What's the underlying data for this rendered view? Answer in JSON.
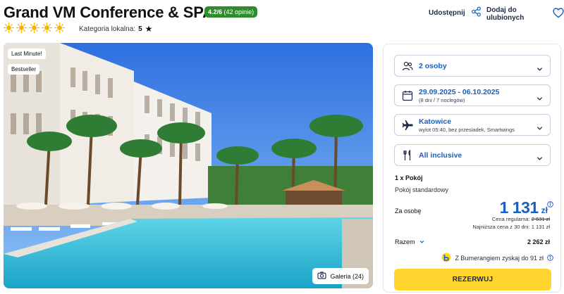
{
  "hotel": {
    "name": "Grand VM Conference & SPA",
    "rating": "4.2/6",
    "reviews": "(42 opinie)",
    "sun_count": 5,
    "category_label": "Kategoria lokalna:",
    "category_value": "5"
  },
  "actions": {
    "share_label": "Udostępnij",
    "favorite_label": "Dodaj do ulubionych"
  },
  "photo": {
    "badges": [
      "Last Minute!",
      "Bestseller"
    ],
    "gallery_label": "Galeria (24)"
  },
  "booking": {
    "guests": "2 osoby",
    "dates": "29.09.2025 - 06.10.2025",
    "dates_sub": "(8 dni / 7 noclegów)",
    "departure": "Katowice",
    "departure_sub": "wylot 05:40, bez przesiadek, Smartwings",
    "board": "All inclusive",
    "room_count": "1 x Pokój",
    "room_type": "Pokój standardowy",
    "per_person_label": "Za osobę",
    "price": "1 131",
    "currency": "zł",
    "regular_label": "Cena regularna:",
    "regular_price": "2 631 zł",
    "lowest_30d": "Najniższa cena z 30 dni: 1 131 zł",
    "total_label": "Razem",
    "total_value": "2 262 zł",
    "bumerang": "Z Bumerangiem zyskaj do 91 zł",
    "reserve_label": "REZERWUJ"
  },
  "colors": {
    "accent_blue": "#1b5fbf",
    "rating_green": "#2e8b2e",
    "sun_yellow": "#f6b400",
    "cta_yellow": "#ffd52e"
  }
}
